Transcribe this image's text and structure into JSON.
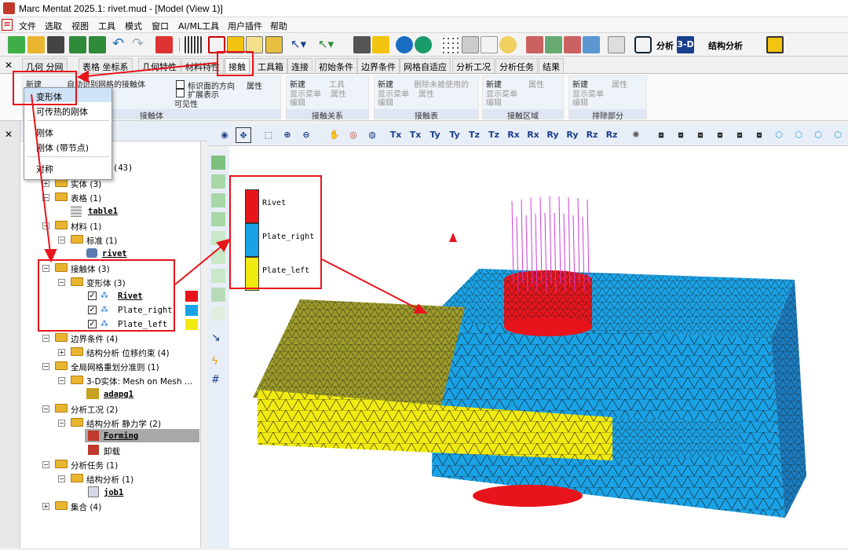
{
  "app": {
    "title": "Marc Mentat 2025.1: rivet.mud - [Model (View 1)]"
  },
  "menu": [
    "文件",
    "选取",
    "视图",
    "工具",
    "模式",
    "窗口",
    "AI/ML工具",
    "用户插件",
    "帮助"
  ],
  "toolbar": {
    "analysis_label": "分析",
    "mode_label": "3-D",
    "structural_label": "结构分析"
  },
  "tabs": [
    "几何",
    "分网",
    "表格",
    "坐标系",
    "几何特性",
    "材料特性",
    "接触",
    "工具箱",
    "连接",
    "初始条件",
    "边界条件",
    "网格自适应",
    "分析工况",
    "分析任务",
    "结果"
  ],
  "active_tab": "接触",
  "ribbon": {
    "contact_body": {
      "new": "新建",
      "auto": "自动识别网格的接触体",
      "identify_dir": "标识面的方向",
      "attr": "属性",
      "extend": "扩展表示",
      "visibility": "可见性",
      "label": "接触体"
    },
    "contact_rel": {
      "new": "新建",
      "tools": "工具",
      "show_menu": "显示菜单",
      "attr": "属性",
      "edit": "编辑",
      "label": "接触关系"
    },
    "contact_table": {
      "new": "新建",
      "delete_unused": "删除未被使用的",
      "show_menu": "显示菜单",
      "attr": "属性",
      "edit": "编辑",
      "label": "接触表"
    },
    "contact_area": {
      "new": "新建",
      "attr": "属性",
      "show_menu": "显示菜单",
      "edit": "编辑",
      "label": "接触区域"
    },
    "exclude": {
      "new": "新建",
      "attr": "属性",
      "show_menu": "显示菜单",
      "edit": "编辑",
      "label": "排除部分"
    }
  },
  "popup": {
    "items": [
      "变形体",
      "可传热的刚体",
      "刚体",
      "刚体 (带节点)",
      "对称"
    ]
  },
  "tree": {
    "root": "(43)",
    "solid": "实体 (3)",
    "tables": "表格 (1)",
    "table1": "table1",
    "materials": "材料 (1)",
    "standard": "标准 (1)",
    "rivet_mat": "rivet",
    "contact": "接触体 (3)",
    "deformable": "变形体 (3)",
    "bodies": [
      {
        "name": "Rivet",
        "color": "#e8141b",
        "bold": true
      },
      {
        "name": "Plate_right",
        "color": "#1aa2e6",
        "bold": false
      },
      {
        "name": "Plate_left",
        "color": "#f1ea10",
        "bold": false
      }
    ],
    "bc": "边界条件 (4)",
    "bc_struct": "结构分析 位移约束 (4)",
    "remesh": "全局网格重划分准则 (1)",
    "remesh_3d": "3-D实体: Mesh on Mesh …",
    "adapg1": "adapg1",
    "loadcases": "分析工况 (2)",
    "lc_struct": "结构分析 静力学 (2)",
    "forming": "Forming",
    "unload": "卸载",
    "jobs": "分析任务 (1)",
    "job_struct": "结构分析 (1)",
    "job1": "job1",
    "sets": "集合 (4)"
  },
  "legend": [
    {
      "name": "Rivet",
      "color": "#e8141b"
    },
    {
      "name": "Plate_right",
      "color": "#1aa2e6"
    },
    {
      "name": "Plate_left",
      "color": "#f1ea10"
    }
  ],
  "viewtools": [
    "Tx",
    "Tx",
    "Ty",
    "Ty",
    "Tz",
    "Tz",
    "Rx",
    "Rx",
    "Ry",
    "Ry",
    "Rz",
    "Rz"
  ],
  "colors": {
    "accent": "#e8141b",
    "rivet": "#e8141b",
    "plate_right": "#1aa2e6",
    "plate_left": "#f1ea10",
    "plate_left_dark": "#9c9a2a"
  }
}
